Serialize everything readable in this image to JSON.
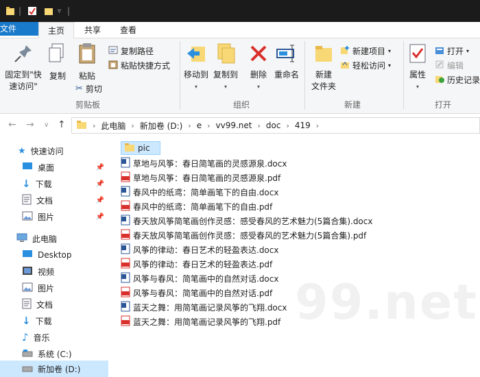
{
  "ribbon_tabs": [
    "文件",
    "主页",
    "共享",
    "查看"
  ],
  "clipboard": {
    "pin_label_1": "固定到\"快",
    "pin_label_2": "速访问\"",
    "copy": "复制",
    "paste": "粘贴",
    "copy_path": "复制路径",
    "paste_shortcut": "粘贴快捷方式",
    "cut": "剪切",
    "group": "剪贴板"
  },
  "organize": {
    "move_to": "移动到",
    "copy_to": "复制到",
    "delete": "删除",
    "rename": "重命名",
    "group": "组织"
  },
  "new": {
    "new_folder_1": "新建",
    "new_folder_2": "文件夹",
    "new_item": "新建项目",
    "easy_access": "轻松访问",
    "group": "新建"
  },
  "open": {
    "properties": "属性",
    "open": "打开",
    "edit": "编辑",
    "history": "历史记录",
    "group": "打开"
  },
  "breadcrumb": [
    "此电脑",
    "新加卷 (D:)",
    "e",
    "vv99.net",
    "doc",
    "419"
  ],
  "sidebar": {
    "quick_access": "快速访问",
    "quick_items": [
      "桌面",
      "下载",
      "文档",
      "图片"
    ],
    "this_pc": "此电脑",
    "pc_items": [
      "Desktop",
      "视频",
      "图片",
      "文档",
      "下载",
      "音乐",
      "系统 (C:)",
      "新加卷 (D:)"
    ]
  },
  "files": [
    {
      "name": "pic",
      "type": "folder"
    },
    {
      "name": "草地与风筝：春日简笔画的灵感源泉.docx",
      "type": "docx"
    },
    {
      "name": "草地与风筝：春日简笔画的灵感源泉.pdf",
      "type": "pdf"
    },
    {
      "name": "春风中的纸鸢：简单画笔下的自由.docx",
      "type": "docx"
    },
    {
      "name": "春风中的纸鸢：简单画笔下的自由.pdf",
      "type": "pdf"
    },
    {
      "name": "春天放风筝简笔画创作灵感：感受春风的艺术魅力(5篇合集).docx",
      "type": "docx"
    },
    {
      "name": "春天放风筝简笔画创作灵感：感受春风的艺术魅力(5篇合集).pdf",
      "type": "pdf"
    },
    {
      "name": "风筝的律动：春日艺术的轻盈表达.docx",
      "type": "docx"
    },
    {
      "name": "风筝的律动：春日艺术的轻盈表达.pdf",
      "type": "pdf"
    },
    {
      "name": "风筝与春风：简笔画中的自然对话.docx",
      "type": "docx"
    },
    {
      "name": "风筝与春风：简笔画中的自然对话.pdf",
      "type": "pdf"
    },
    {
      "name": "蓝天之舞：用简笔画记录风筝的飞翔.docx",
      "type": "docx"
    },
    {
      "name": "蓝天之舞：用简笔画记录风筝的飞翔.pdf",
      "type": "pdf"
    }
  ],
  "watermark": "99.net",
  "colors": {
    "accent": "#1979ca",
    "folder": "#f8d775",
    "pdf": "#d9302c",
    "docx": "#2b5797",
    "selection": "#cce8ff"
  }
}
